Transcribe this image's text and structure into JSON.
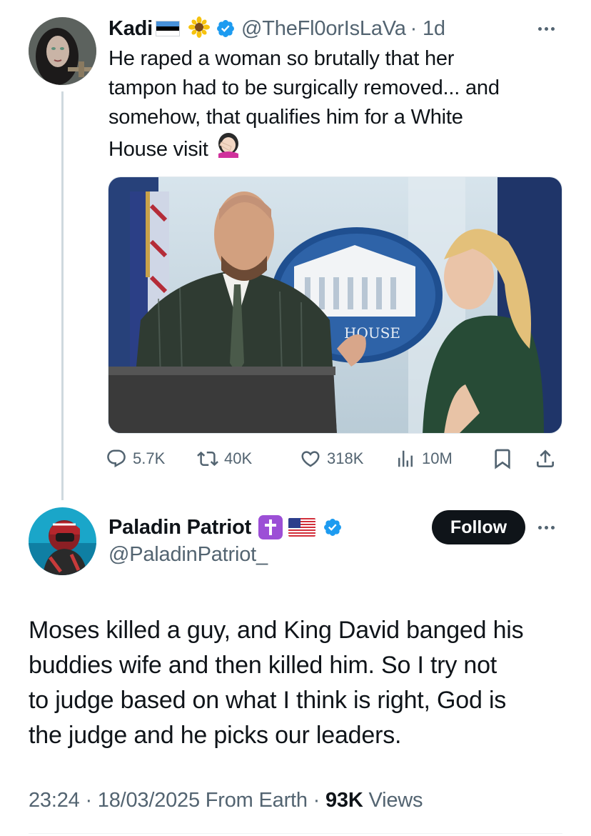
{
  "tweet": {
    "author_name": "Kadi",
    "author_handle": "@TheFl0orIsLaVa",
    "time_ago": "· 1d",
    "text_lines": [
      "He raped a woman so brutally that her",
      "tampon had to be surgically removed... and",
      "somehow, that qualifies him for a White",
      "House visit"
    ],
    "emoji_after_name": "🌻",
    "emoji_end": "🤦🏻‍♀️",
    "icons": {
      "flag": "estonia-flag-icon",
      "verified": "verified-badge-icon",
      "more": "more-options-icon"
    },
    "media_alt_content": "photo at a briefing podium",
    "media_sign_text": "HOUSE",
    "actions": {
      "replies": "5.7K",
      "retweets": "40K",
      "likes": "318K",
      "views": "10M"
    }
  },
  "reply": {
    "author_name": "Paladin Patriot",
    "author_handle": "@PaladinPatriot_",
    "follow_label": "Follow",
    "text_lines": [
      "Moses killed a guy, and King David banged his",
      "buddies wife and then killed him. So I try not",
      "to judge based on what I think is right, God is",
      "the judge and he picks our leaders."
    ],
    "meta": {
      "time": "23:24",
      "date": "18/03/2025",
      "source": "From Earth",
      "sep": "·",
      "views_count": "93K",
      "views_label": "Views"
    }
  },
  "colors": {
    "text": "#0f1419",
    "secondary": "#536471",
    "verified_blue": "#1d9bf0",
    "follow_bg": "#0f1419"
  }
}
